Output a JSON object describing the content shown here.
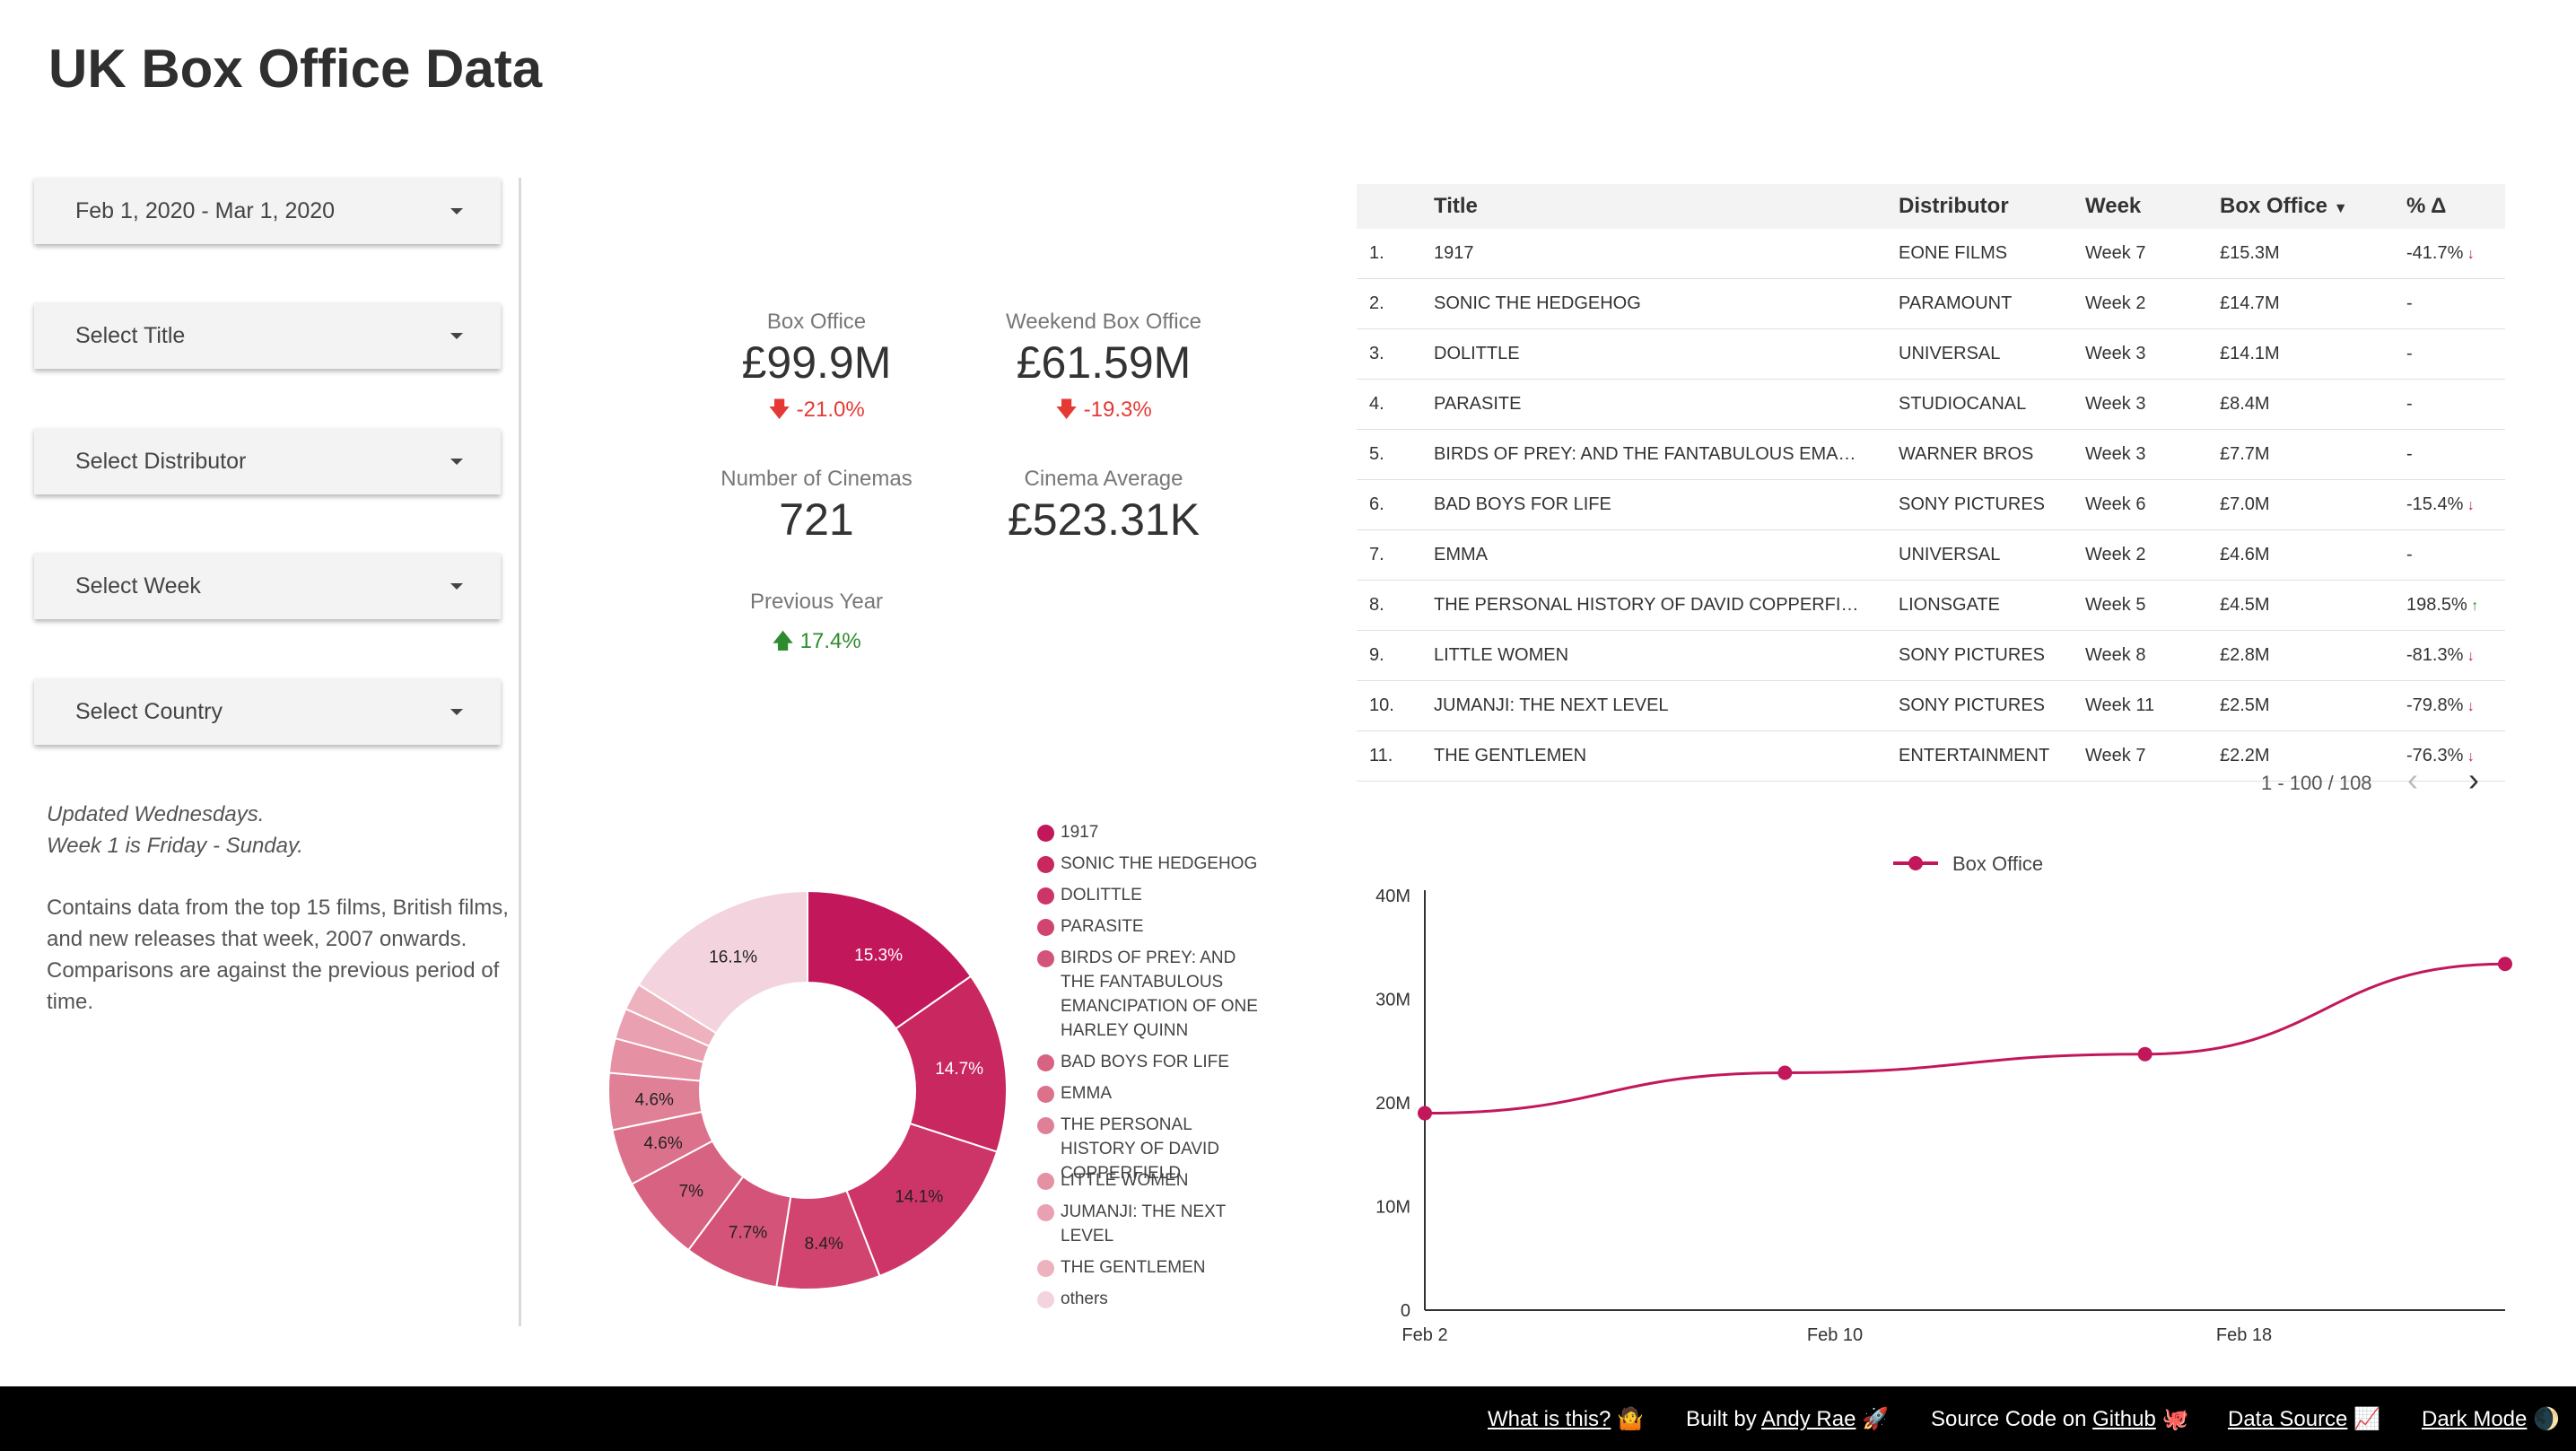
{
  "page": {
    "title": "UK Box Office Data"
  },
  "filters": {
    "date_range": "Feb 1, 2020 - Mar 1, 2020",
    "title": "Select Title",
    "distributor": "Select Distributor",
    "week": "Select Week",
    "country": "Select Country"
  },
  "notes": {
    "line1": "Updated Wednesdays.",
    "line2": "Week 1 is Friday - Sunday.",
    "para2": "Contains data from the top 15 films, British films, and new releases that week, 2007 onwards.",
    "para3": "Comparisons are against the previous period of time."
  },
  "kpis": {
    "box_office": {
      "label": "Box Office",
      "value": "£99.9M",
      "delta": "-21.0%",
      "direction": "down"
    },
    "weekend_box_office": {
      "label": "Weekend Box Office",
      "value": "£61.59M",
      "delta": "-19.3%",
      "direction": "down"
    },
    "cinemas": {
      "label": "Number of Cinemas",
      "value": "721"
    },
    "cinema_average": {
      "label": "Cinema Average",
      "value": "£523.31K"
    },
    "previous_year": {
      "label": "Previous Year",
      "delta": "17.4%",
      "direction": "up"
    }
  },
  "table": {
    "headers": [
      "Title",
      "Distributor",
      "Week",
      "Box Office",
      "% Δ"
    ],
    "rows": [
      [
        "1.",
        "1917",
        "EONE FILMS",
        "Week 7",
        "£15.3M",
        "-41.7%",
        "down"
      ],
      [
        "2.",
        "SONIC THE HEDGEHOG",
        "PARAMOUNT",
        "Week 2",
        "£14.7M",
        "-",
        ""
      ],
      [
        "3.",
        "DOLITTLE",
        "UNIVERSAL",
        "Week 3",
        "£14.1M",
        "-",
        ""
      ],
      [
        "4.",
        "PARASITE",
        "STUDIOCANAL",
        "Week 3",
        "£8.4M",
        "-",
        ""
      ],
      [
        "5.",
        "BIRDS OF PREY: AND THE FANTABULOUS EMANC...",
        "WARNER BROS",
        "Week 3",
        "£7.7M",
        "-",
        ""
      ],
      [
        "6.",
        "BAD BOYS FOR LIFE",
        "SONY PICTURES",
        "Week 6",
        "£7.0M",
        "-15.4%",
        "down"
      ],
      [
        "7.",
        "EMMA",
        "UNIVERSAL",
        "Week 2",
        "£4.6M",
        "-",
        ""
      ],
      [
        "8.",
        "THE PERSONAL HISTORY OF DAVID COPPERFIELD",
        "LIONSGATE",
        "Week 5",
        "£4.5M",
        "198.5%",
        "up"
      ],
      [
        "9.",
        "LITTLE WOMEN",
        "SONY PICTURES",
        "Week 8",
        "£2.8M",
        "-81.3%",
        "down"
      ],
      [
        "10.",
        "JUMANJI: THE NEXT LEVEL",
        "SONY PICTURES",
        "Week 11",
        "£2.5M",
        "-79.8%",
        "down"
      ],
      [
        "11.",
        "THE GENTLEMEN",
        "ENTERTAINMENT",
        "Week 7",
        "£2.2M",
        "-76.3%",
        "down"
      ]
    ],
    "pagination": "1 - 100 / 108"
  },
  "chart_data": [
    {
      "type": "pie",
      "variant": "donut",
      "labels": [
        "1917",
        "SONIC THE HEDGEHOG",
        "DOLITTLE",
        "PARASITE",
        "BIRDS OF PREY: AND THE FANTABULOUS EMANCIPATION OF ONE HARLEY QUINN",
        "BAD BOYS FOR LIFE",
        "EMMA",
        "THE PERSONAL HISTORY OF DAVID COPPERFIELD",
        "LITTLE WOMEN",
        "JUMANJI: THE NEXT LEVEL",
        "THE GENTLEMEN",
        "others"
      ],
      "values": [
        15.3,
        14.7,
        14.1,
        8.4,
        7.7,
        7.0,
        4.6,
        4.6,
        2.8,
        2.5,
        2.2,
        16.1
      ],
      "value_labels": [
        "15.3%",
        "14.7%",
        "14.1%",
        "8.4%",
        "7.7%",
        "7%",
        "4.6%",
        "4.6%",
        "",
        "",
        "",
        "16.1%"
      ],
      "colors": [
        "#c2185b",
        "#c8275f",
        "#cd3467",
        "#d1446f",
        "#d45378",
        "#d86282",
        "#dc718c",
        "#e08097",
        "#e590a3",
        "#e9a0b0",
        "#eeb1be",
        "#f3d3dd"
      ],
      "legend": "right"
    },
    {
      "type": "line",
      "series": [
        {
          "name": "Box Office",
          "x": [
            "Feb 2",
            "Feb 9",
            "Feb 16",
            "Feb 23"
          ],
          "values": [
            19.0,
            22.9,
            24.7,
            33.4
          ]
        }
      ],
      "x_ticks": [
        "Feb 2",
        "Feb 10",
        "Feb 18"
      ],
      "y_ticks": [
        "0",
        "10M",
        "20M",
        "30M",
        "40M"
      ],
      "ylim": [
        0,
        40
      ],
      "legend": "top",
      "color": "#c2185b"
    }
  ],
  "footer": {
    "what": "What is this?",
    "what_icon": "🤷",
    "built_prefix": "Built by",
    "built_link": "Andy Rae",
    "built_icon": "🚀",
    "source_prefix": "Source Code on",
    "source_link": "Github",
    "source_icon": "🐙",
    "data_source": "Data Source",
    "data_icon": "📈",
    "dark_mode": "Dark Mode",
    "dark_icon": "🌒"
  }
}
